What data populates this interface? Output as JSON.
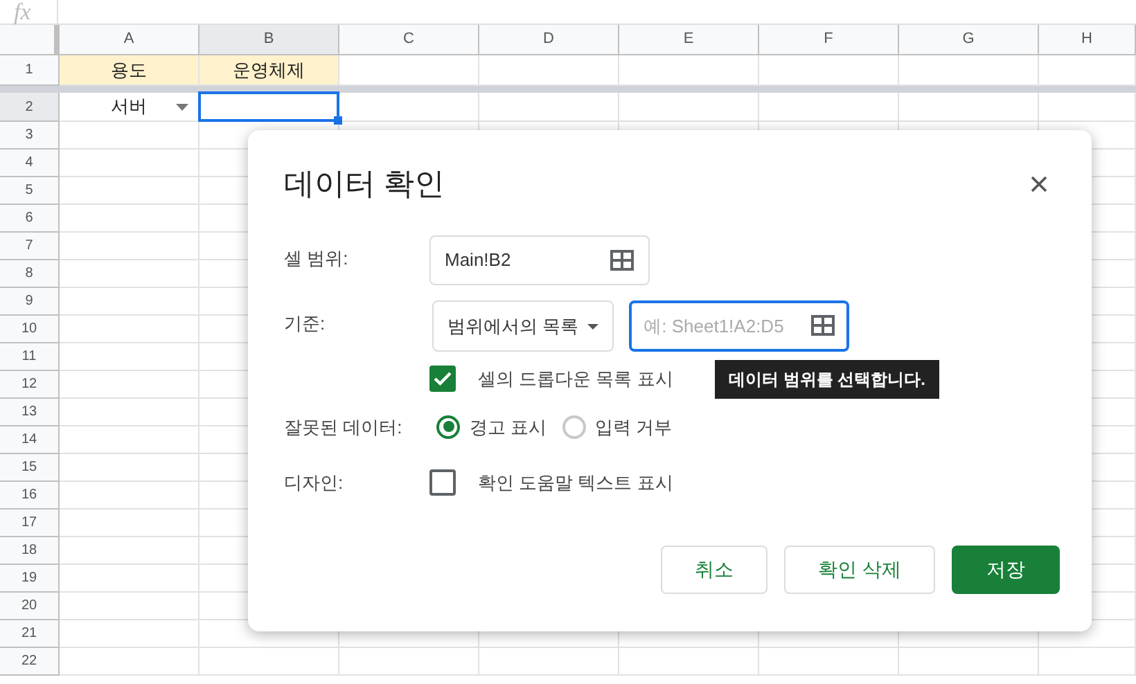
{
  "formula_bar": {
    "label": "fx"
  },
  "columns": [
    {
      "label": "A",
      "selected": false
    },
    {
      "label": "B",
      "selected": true
    },
    {
      "label": "C",
      "selected": false
    },
    {
      "label": "D",
      "selected": false
    },
    {
      "label": "E",
      "selected": false
    },
    {
      "label": "F",
      "selected": false
    },
    {
      "label": "G",
      "selected": false
    },
    {
      "label": "H",
      "selected": false
    }
  ],
  "rows": [
    {
      "number": "1",
      "selected": false,
      "kind": "header",
      "cells": [
        {
          "text": "용도"
        },
        {
          "text": "운영체제"
        }
      ]
    },
    {
      "number": "2",
      "selected": true,
      "kind": "data",
      "cells": [
        {
          "text": "서버",
          "dropdown": true
        },
        {
          "selected": true
        }
      ]
    },
    {
      "number": "3",
      "selected": false
    },
    {
      "number": "4",
      "selected": false
    },
    {
      "number": "5",
      "selected": false
    },
    {
      "number": "6",
      "selected": false
    },
    {
      "number": "7",
      "selected": false
    },
    {
      "number": "8",
      "selected": false
    },
    {
      "number": "9",
      "selected": false
    },
    {
      "number": "10",
      "selected": false
    },
    {
      "number": "11",
      "selected": false
    },
    {
      "number": "12",
      "selected": false
    },
    {
      "number": "13",
      "selected": false
    },
    {
      "number": "14",
      "selected": false
    },
    {
      "number": "15",
      "selected": false
    },
    {
      "number": "16",
      "selected": false
    },
    {
      "number": "17",
      "selected": false
    },
    {
      "number": "18",
      "selected": false
    },
    {
      "number": "19",
      "selected": false
    },
    {
      "number": "20",
      "selected": false
    },
    {
      "number": "21",
      "selected": false
    },
    {
      "number": "22",
      "selected": false
    }
  ],
  "dialog": {
    "title": "데이터 확인",
    "cell_range": {
      "label": "셀 범위:",
      "value": "Main!B2"
    },
    "criteria": {
      "label": "기준:",
      "dropdown": "범위에서의 목록",
      "placeholder": "예: Sheet1!A2:D5",
      "focused": true,
      "tooltip": "데이터 범위를 선택합니다."
    },
    "show_dropdown": {
      "label": "셀의 드롭다운 목록 표시",
      "checked": true
    },
    "invalid_data": {
      "label": "잘못된 데이터:",
      "options": [
        {
          "label": "경고 표시",
          "selected": true
        },
        {
          "label": "입력 거부",
          "selected": false
        }
      ]
    },
    "appearance": {
      "label": "디자인:",
      "checkbox": {
        "label": "확인 도움말 텍스트 표시",
        "checked": false
      }
    },
    "buttons": [
      {
        "label": "취소",
        "kind": "secondary"
      },
      {
        "label": "확인 삭제",
        "kind": "secondary"
      },
      {
        "label": "저장",
        "kind": "primary"
      }
    ]
  }
}
